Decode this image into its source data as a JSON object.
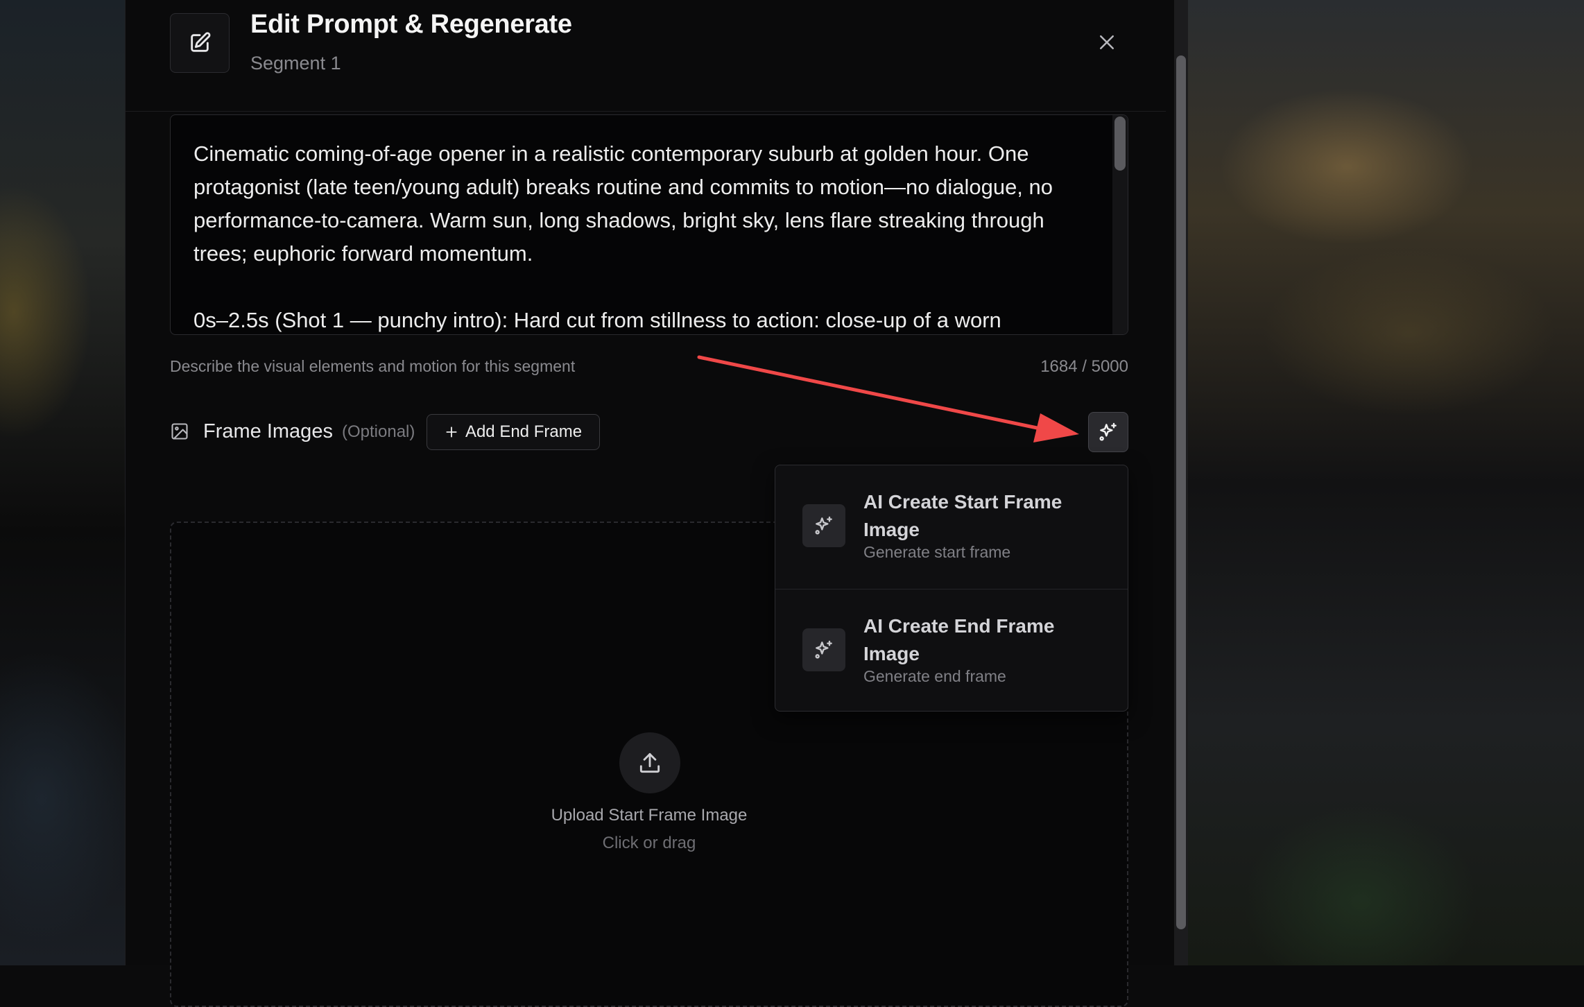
{
  "modal": {
    "title": "Edit Prompt & Regenerate",
    "subtitle": "Segment 1"
  },
  "prompt": {
    "text": "Cinematic coming-of-age opener in a realistic contemporary suburb at golden hour. One protagonist (late teen/young adult) breaks routine and commits to motion—no dialogue, no performance-to-camera. Warm sun, long shadows, bright sky, lens flare streaking through trees; euphoric forward momentum.\n\n0s–2.5s (Shot 1 — punchy intro): Hard cut from stillness to action: close-up of a worn",
    "hint": "Describe the visual elements and motion for this segment",
    "char_count": "1684 / 5000"
  },
  "frames": {
    "label": "Frame Images",
    "optional": "(Optional)",
    "add_end_frame": "Add End Frame"
  },
  "ai_menu": {
    "items": [
      {
        "title": "AI Create Start Frame Image",
        "subtitle": "Generate start frame"
      },
      {
        "title": "AI Create End Frame Image",
        "subtitle": "Generate end frame"
      }
    ]
  },
  "upload": {
    "title": "Upload Start Frame Image",
    "subtitle": "Click or drag"
  },
  "colors": {
    "annotation_arrow": "#f04848",
    "modal_bg": "#0a0a0b"
  }
}
